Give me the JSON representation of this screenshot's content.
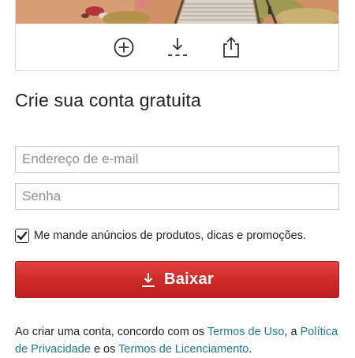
{
  "colors": {
    "accent_red": "#cc2a28",
    "link_teal": "#1f7a8c",
    "placeholder_gray": "#8f8f8f",
    "border_gray": "#c9c9c9"
  },
  "image_card": {
    "actions": [
      {
        "icon": "add-circle-icon"
      },
      {
        "icon": "download-icon"
      },
      {
        "icon": "share-icon"
      }
    ]
  },
  "signup": {
    "title": "Crie sua conta gratuita",
    "email_placeholder": "Endereço de e-mail",
    "password_placeholder": "Senha",
    "opt_in_label": "Me mande anúncios de produtos, dicas e promoções.",
    "opt_in_checked": true,
    "download_label": "Baixar",
    "download_icon": "download-icon"
  },
  "terms": {
    "prefix": "Ao criar uma conta, concordo com os ",
    "terms_of_use": "Termos de Uso",
    "sep1": ", a ",
    "privacy_policy": "Política de Privacidade",
    "sep2": " e os ",
    "licensing_terms": "Termos de Licenciamento",
    "suffix": "."
  }
}
